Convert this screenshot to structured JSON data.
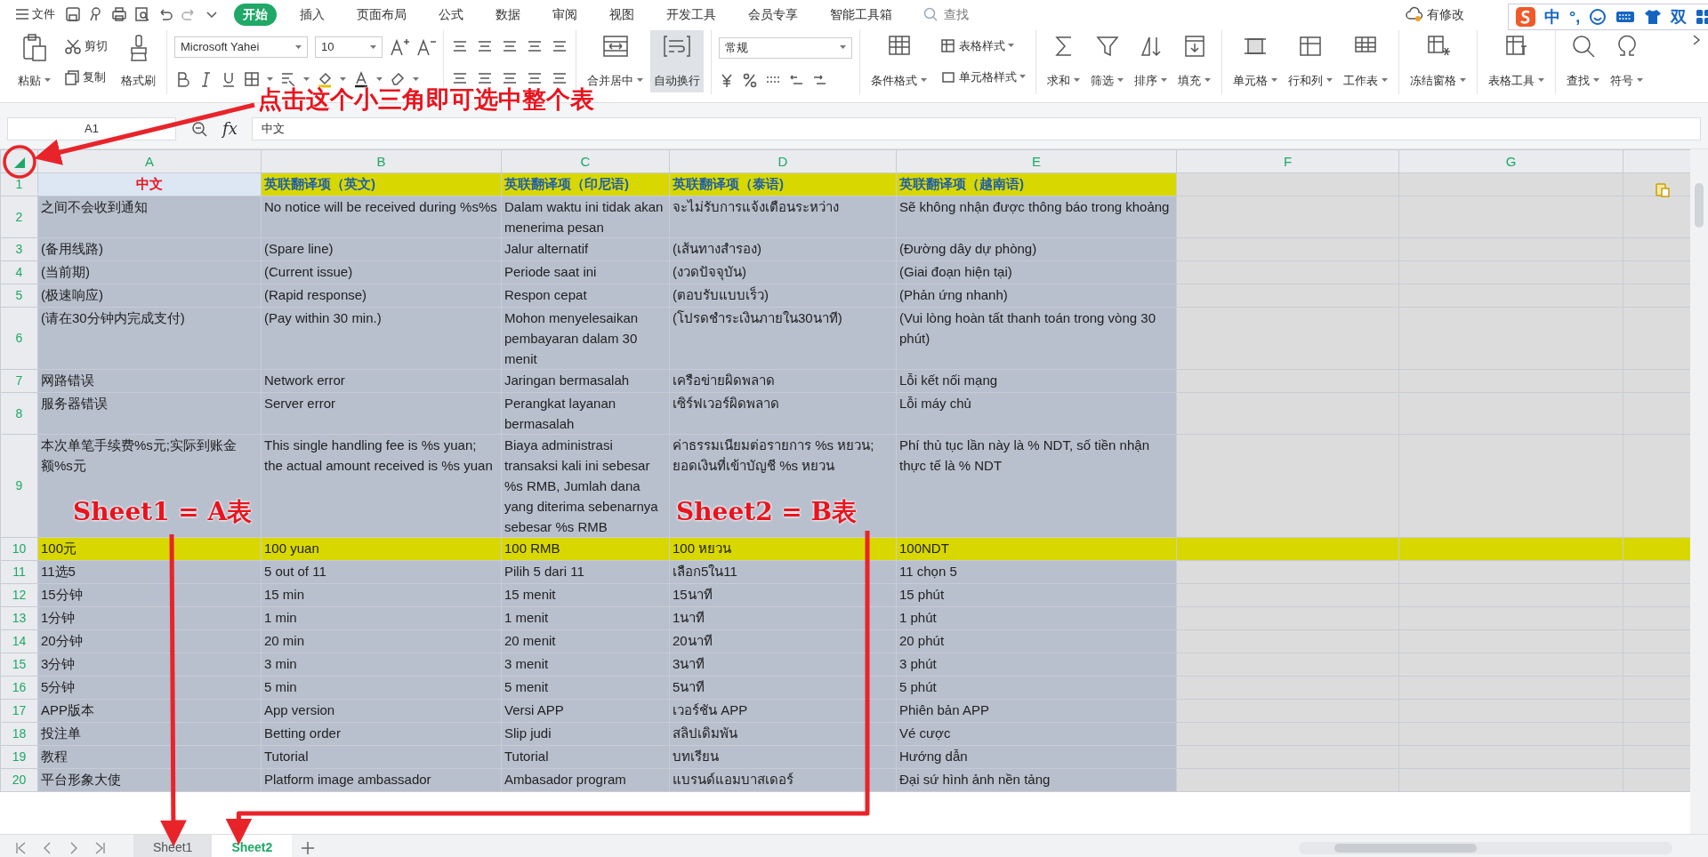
{
  "menu_bar": {
    "file_menu": "文件",
    "tabs": [
      {
        "label": "开始",
        "selected": true
      },
      {
        "label": "插入",
        "selected": false
      },
      {
        "label": "页面布局",
        "selected": false
      },
      {
        "label": "公式",
        "selected": false
      },
      {
        "label": "数据",
        "selected": false
      },
      {
        "label": "审阅",
        "selected": false
      },
      {
        "label": "视图",
        "selected": false
      },
      {
        "label": "开发工具",
        "selected": false
      },
      {
        "label": "会员专享",
        "selected": false
      },
      {
        "label": "智能工具箱",
        "selected": false
      }
    ],
    "search": {
      "placeholder": "查找"
    },
    "cloud_status": "有修改"
  },
  "ime_bar": {
    "items": [
      "中",
      "°,",
      "双"
    ]
  },
  "ribbon": {
    "clipboard": {
      "paste": "粘贴",
      "cut": "剪切",
      "copy": "复制",
      "format_painter": "格式刷"
    },
    "font": {
      "name": "Microsoft Yahei",
      "size": "10"
    },
    "merge": "合并居中",
    "wrap": {
      "label": "自动换行",
      "selected": true
    },
    "number_format": "常规",
    "styles": {
      "table_style": "表格样式",
      "conditional_format": "条件格式",
      "cell_style": "单元格样式"
    },
    "tools": [
      {
        "label": "求和"
      },
      {
        "label": "筛选"
      },
      {
        "label": "排序"
      },
      {
        "label": "填充"
      },
      {
        "label": "单元格"
      },
      {
        "label": "行和列"
      },
      {
        "label": "工作表"
      },
      {
        "label": "冻结窗格"
      },
      {
        "label": "表格工具"
      },
      {
        "label": "查找"
      },
      {
        "label": "符号"
      }
    ]
  },
  "formula_bar": {
    "cell_ref": "A1",
    "fx": "fx",
    "value": "中文"
  },
  "sheet": {
    "columns": [
      "A",
      "B",
      "C",
      "D",
      "E",
      "F",
      "G"
    ],
    "rows": [
      {
        "number": "1",
        "kind": "header",
        "cells": [
          "中文",
          "英联翻译项（英文)",
          "英联翻译项（印尼语)",
          "英联翻译项（泰语)",
          "英联翻译项（越南语)"
        ]
      },
      {
        "number": "2",
        "kind": "data",
        "cells": [
          "之间不会收到通知",
          "No notice will be received during %s%s",
          "Dalam waktu ini tidak akan menerima pesan",
          "จะไม่รับการแจ้งเตือนระหว่าง",
          "Sẽ không nhận được thông báo trong khoảng"
        ]
      },
      {
        "number": "3",
        "kind": "data",
        "cells": [
          "(备用线路)",
          "(Spare line)",
          "Jalur alternatif",
          "(เส้นทางสำรอง)",
          "(Đường dây dự phòng)"
        ]
      },
      {
        "number": "4",
        "kind": "data",
        "cells": [
          "(当前期)",
          "(Current issue)",
          "Periode saat ini",
          "(งวดปัจจุบัน)",
          "(Giai đoạn hiện tại)"
        ]
      },
      {
        "number": "5",
        "kind": "data",
        "cells": [
          "(极速响应)",
          "(Rapid response)",
          "Respon cepat",
          "(ตอบรับแบบเร็ว)",
          "(Phản ứng nhanh)"
        ]
      },
      {
        "number": "6",
        "kind": "data",
        "cells": [
          "(请在30分钟内完成支付)",
          "(Pay within 30 min.)",
          "Mohon menyelesaikan pembayaran dalam 30 menit",
          "(โปรดชำระเงินภายใน30นาที)",
          "(Vui lòng hoàn tất thanh toán trong vòng 30 phút)"
        ]
      },
      {
        "number": "7",
        "kind": "data",
        "cells": [
          "网路错误",
          "Network error",
          "Jaringan bermasalah",
          "เครือข่ายผิดพลาด",
          "Lỗi kết nối mạng"
        ]
      },
      {
        "number": "8",
        "kind": "data",
        "cells": [
          "服务器错误",
          "Server error",
          "Perangkat layanan bermasalah",
          "เซิร์ฟเวอร์ผิดพลาด",
          "Lỗi máy chủ"
        ]
      },
      {
        "number": "9",
        "kind": "data",
        "cells": [
          "本次单笔手续费%s元;实际到账金额%s元",
          "This single handling fee is %s yuan; the actual amount received is %s yuan",
          "Biaya administrasi transaksi kali ini sebesar %s RMB, Jumlah dana yang diterima sebenarnya sebesar %s RMB",
          "ค่าธรรมเนียมต่อรายการ %s หยวน; ยอดเงินที่เข้าบัญชี %s หยวน",
          "Phí thủ tục lần này là % NDT, số tiền nhận thực tế là % NDT"
        ]
      },
      {
        "number": "10",
        "kind": "highlight",
        "cells": [
          "100元",
          "100 yuan",
          "100 RMB",
          "100 หยวน",
          "100NDT"
        ]
      },
      {
        "number": "11",
        "kind": "data",
        "cells": [
          "11选5",
          "5 out of 11",
          "Pilih 5 dari 11",
          "เลือก5ใน11",
          "11 chọn 5"
        ]
      },
      {
        "number": "12",
        "kind": "data",
        "cells": [
          "15分钟",
          "15 min",
          "15 menit",
          "15นาที",
          "15 phút"
        ]
      },
      {
        "number": "13",
        "kind": "data",
        "cells": [
          "1分钟",
          "1 min",
          "1 menit",
          "1นาที",
          "1 phút"
        ]
      },
      {
        "number": "14",
        "kind": "data",
        "cells": [
          "20分钟",
          "20 min",
          "20 menit",
          "20นาที",
          "20 phút"
        ]
      },
      {
        "number": "15",
        "kind": "data",
        "cells": [
          "3分钟",
          "3 min",
          "3 menit",
          "3นาที",
          "3 phút"
        ]
      },
      {
        "number": "16",
        "kind": "data",
        "cells": [
          "5分钟",
          "5 min",
          "5 menit",
          "5นาที",
          "5 phút"
        ]
      },
      {
        "number": "17",
        "kind": "data",
        "cells": [
          "APP版本",
          "App version",
          "Versi APP",
          "เวอร์ชัน APP",
          "Phiên bản APP"
        ]
      },
      {
        "number": "18",
        "kind": "data",
        "cells": [
          "投注单",
          "Betting order",
          "Slip judi",
          "สลิปเดิมพัน",
          "Vé cược"
        ]
      },
      {
        "number": "19",
        "kind": "data",
        "cells": [
          "教程",
          "Tutorial",
          "Tutorial",
          "บทเรียน",
          "Hướng dẫn"
        ]
      },
      {
        "number": "20",
        "kind": "data",
        "cells": [
          "平台形象大使",
          "Platform image ambassador",
          "Ambasador program",
          "แบรนด์แอมบาสเดอร์",
          "Đại sứ hình ảnh nền tảng"
        ]
      }
    ]
  },
  "sheet_tabs": [
    {
      "label": "Sheet1",
      "selected": false
    },
    {
      "label": "Sheet2",
      "selected": true
    }
  ],
  "annotations": [
    {
      "text": "点击这个小三角即可选中整个表"
    },
    {
      "text": "Sheet1 = A表"
    },
    {
      "text": "Sheet2 = B表"
    }
  ]
}
